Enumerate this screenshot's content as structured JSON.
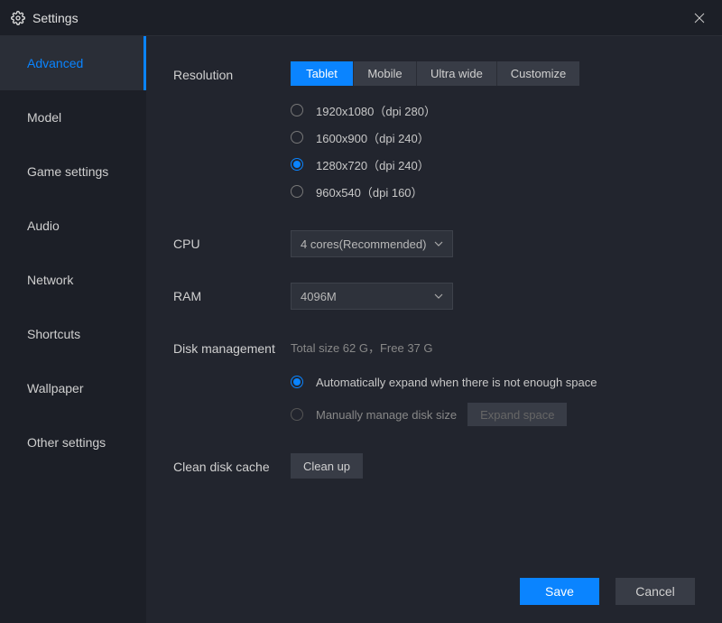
{
  "window": {
    "title": "Settings"
  },
  "sidebar": {
    "items": [
      {
        "label": "Advanced",
        "active": true
      },
      {
        "label": "Model",
        "active": false
      },
      {
        "label": "Game settings",
        "active": false
      },
      {
        "label": "Audio",
        "active": false
      },
      {
        "label": "Network",
        "active": false
      },
      {
        "label": "Shortcuts",
        "active": false
      },
      {
        "label": "Wallpaper",
        "active": false
      },
      {
        "label": "Other settings",
        "active": false
      }
    ]
  },
  "resolution": {
    "label": "Resolution",
    "tabs": [
      {
        "label": "Tablet",
        "active": true
      },
      {
        "label": "Mobile",
        "active": false
      },
      {
        "label": "Ultra wide",
        "active": false
      },
      {
        "label": "Customize",
        "active": false
      }
    ],
    "options": [
      {
        "label": "1920x1080（dpi 280）",
        "selected": false
      },
      {
        "label": "1600x900（dpi 240）",
        "selected": false
      },
      {
        "label": "1280x720（dpi 240）",
        "selected": true
      },
      {
        "label": "960x540（dpi 160）",
        "selected": false
      }
    ]
  },
  "cpu": {
    "label": "CPU",
    "value": "4 cores(Recommended)"
  },
  "ram": {
    "label": "RAM",
    "value": "4096M"
  },
  "disk": {
    "label": "Disk management",
    "info": "Total size 62 G，Free 37 G",
    "auto_label": "Automatically expand when there is not enough space",
    "manual_label": "Manually manage disk size",
    "expand_button": "Expand space",
    "auto_selected": true
  },
  "clean": {
    "label": "Clean disk cache",
    "button": "Clean up"
  },
  "footer": {
    "save": "Save",
    "cancel": "Cancel"
  }
}
